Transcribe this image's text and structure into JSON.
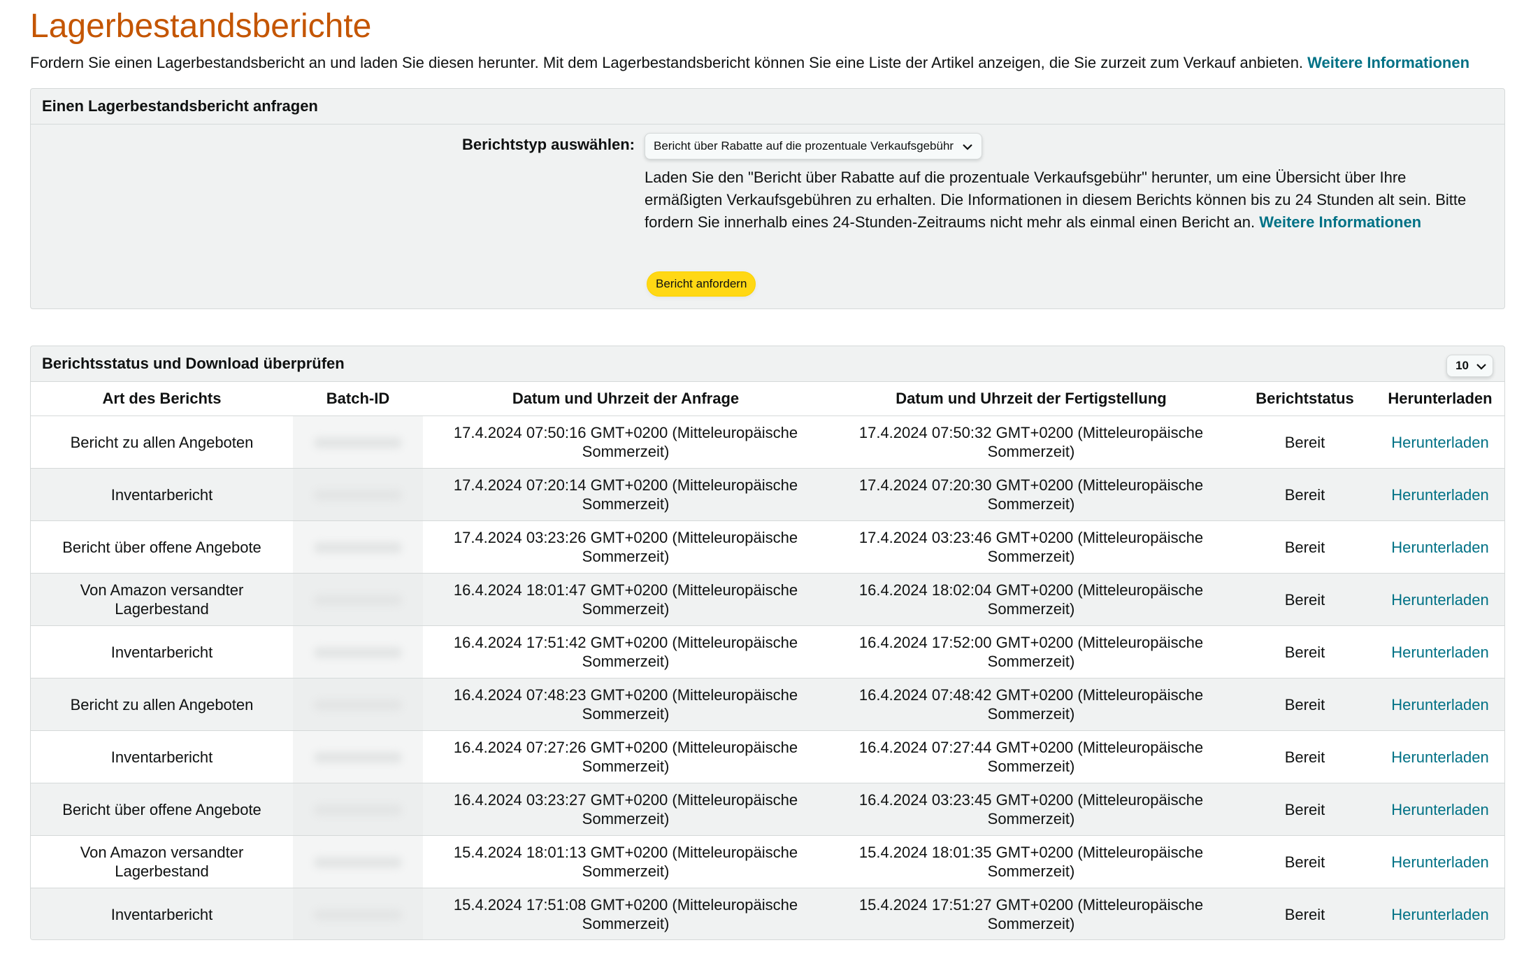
{
  "page": {
    "title": "Lagerbestandsberichte",
    "intro_text": "Fordern Sie einen Lagerbestandsbericht an und laden Sie diesen herunter. Mit dem Lagerbestandsbericht können Sie eine Liste der Artikel anzeigen, die Sie zurzeit zum Verkauf anbieten.",
    "intro_link": "Weitere Informationen"
  },
  "request_panel": {
    "header": "Einen Lagerbestandsbericht anfragen",
    "select_label": "Berichtstyp auswählen:",
    "select_value": "Bericht über Rabatte auf die prozentuale Verkaufsgebühr",
    "description": "Laden Sie den \"Bericht über Rabatte auf die prozentuale Verkaufsgebühr\" herunter, um eine Übersicht über Ihre ermäßigten Verkaufsgebühren zu erhalten. Die Informationen in diesem Berichts können bis zu 24 Stunden alt sein. Bitte fordern Sie innerhalb eines 24-Stunden-Zeitraums nicht mehr als einmal einen Bericht an.",
    "description_link": "Weitere Informationen",
    "button_label": "Bericht anfordern"
  },
  "status_panel": {
    "header": "Berichtsstatus und Download überprüfen",
    "page_size": "10",
    "columns": [
      "Art des Berichts",
      "Batch-ID",
      "Datum und Uhrzeit der Anfrage",
      "Datum und Uhrzeit der Fertigstellung",
      "Berichtstatus",
      "Herunterladen"
    ],
    "rows": [
      {
        "type": "Bericht zu allen Angeboten",
        "requested": "17.4.2024 07:50:16 GMT+0200 (Mitteleuropäische Sommerzeit)",
        "completed": "17.4.2024 07:50:32 GMT+0200 (Mitteleuropäische Sommerzeit)",
        "status": "Bereit",
        "download": "Herunterladen"
      },
      {
        "type": "Inventarbericht",
        "requested": "17.4.2024 07:20:14 GMT+0200 (Mitteleuropäische Sommerzeit)",
        "completed": "17.4.2024 07:20:30 GMT+0200 (Mitteleuropäische Sommerzeit)",
        "status": "Bereit",
        "download": "Herunterladen"
      },
      {
        "type": "Bericht über offene Angebote",
        "requested": "17.4.2024 03:23:26 GMT+0200 (Mitteleuropäische Sommerzeit)",
        "completed": "17.4.2024 03:23:46 GMT+0200 (Mitteleuropäische Sommerzeit)",
        "status": "Bereit",
        "download": "Herunterladen"
      },
      {
        "type": "Von Amazon versandter Lagerbestand",
        "requested": "16.4.2024 18:01:47 GMT+0200 (Mitteleuropäische Sommerzeit)",
        "completed": "16.4.2024 18:02:04 GMT+0200 (Mitteleuropäische Sommerzeit)",
        "status": "Bereit",
        "download": "Herunterladen"
      },
      {
        "type": "Inventarbericht",
        "requested": "16.4.2024 17:51:42 GMT+0200 (Mitteleuropäische Sommerzeit)",
        "completed": "16.4.2024 17:52:00 GMT+0200 (Mitteleuropäische Sommerzeit)",
        "status": "Bereit",
        "download": "Herunterladen"
      },
      {
        "type": "Bericht zu allen Angeboten",
        "requested": "16.4.2024 07:48:23 GMT+0200 (Mitteleuropäische Sommerzeit)",
        "completed": "16.4.2024 07:48:42 GMT+0200 (Mitteleuropäische Sommerzeit)",
        "status": "Bereit",
        "download": "Herunterladen"
      },
      {
        "type": "Inventarbericht",
        "requested": "16.4.2024 07:27:26 GMT+0200 (Mitteleuropäische Sommerzeit)",
        "completed": "16.4.2024 07:27:44 GMT+0200 (Mitteleuropäische Sommerzeit)",
        "status": "Bereit",
        "download": "Herunterladen"
      },
      {
        "type": "Bericht über offene Angebote",
        "requested": "16.4.2024 03:23:27 GMT+0200 (Mitteleuropäische Sommerzeit)",
        "completed": "16.4.2024 03:23:45 GMT+0200 (Mitteleuropäische Sommerzeit)",
        "status": "Bereit",
        "download": "Herunterladen"
      },
      {
        "type": "Von Amazon versandter Lagerbestand",
        "requested": "15.4.2024 18:01:13 GMT+0200 (Mitteleuropäische Sommerzeit)",
        "completed": "15.4.2024 18:01:35 GMT+0200 (Mitteleuropäische Sommerzeit)",
        "status": "Bereit",
        "download": "Herunterladen"
      },
      {
        "type": "Inventarbericht",
        "requested": "15.4.2024 17:51:08 GMT+0200 (Mitteleuropäische Sommerzeit)",
        "completed": "15.4.2024 17:51:27 GMT+0200 (Mitteleuropäische Sommerzeit)",
        "status": "Bereit",
        "download": "Herunterladen"
      }
    ]
  },
  "colors": {
    "title": "#c45500",
    "link": "#007185",
    "button": "#ffd814",
    "panel_bg": "#f0f2f2"
  },
  "icons": {
    "select_chevron": "chevron-down-icon",
    "page_size_chevron": "chevron-down-icon"
  }
}
